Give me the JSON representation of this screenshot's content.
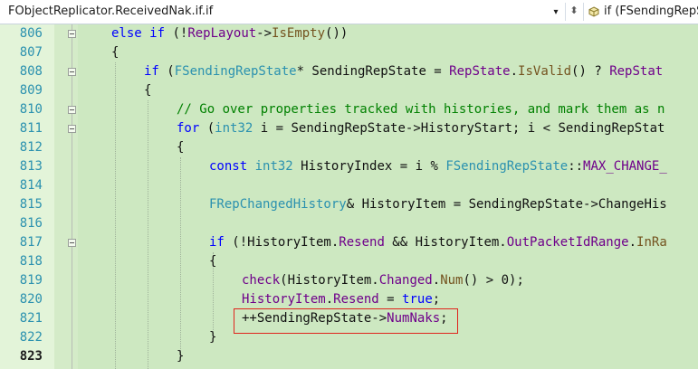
{
  "navbar": {
    "scope_label": "FObjectReplicator.ReceivedNak.if.if",
    "scope_dropdown_glyph": "▾",
    "split_glyph": "⬍",
    "member_label": "if (FSendingRepSt",
    "member_icon": "scope-cube-icon"
  },
  "editor": {
    "current_line": "823",
    "lines": [
      {
        "n": "806"
      },
      {
        "n": "807"
      },
      {
        "n": "808"
      },
      {
        "n": "809"
      },
      {
        "n": "810"
      },
      {
        "n": "811"
      },
      {
        "n": "812"
      },
      {
        "n": "813"
      },
      {
        "n": "814"
      },
      {
        "n": "815"
      },
      {
        "n": "816"
      },
      {
        "n": "817"
      },
      {
        "n": "818"
      },
      {
        "n": "819"
      },
      {
        "n": "820"
      },
      {
        "n": "821"
      },
      {
        "n": "822"
      },
      {
        "n": "823"
      }
    ],
    "code": {
      "l806": {
        "a": "else",
        "b": " ",
        "c": "if",
        "d": " (!",
        "e": "RepLayout",
        "f": "->",
        "g": "IsEmpty",
        "h": "())"
      },
      "l807": {
        "a": "{"
      },
      "l808": {
        "a": "if",
        "b": " (",
        "c": "FSendingRepState",
        "d": "* SendingRepState = ",
        "e": "RepState",
        "f": ".",
        "g": "IsValid",
        "h": "() ? ",
        "i": "RepStat"
      },
      "l809": {
        "a": "{"
      },
      "l810": {
        "a": "// Go over properties tracked with histories, and mark them as n"
      },
      "l811": {
        "a": "for",
        "b": " (",
        "c": "int32",
        "d": " i = SendingRepState->HistoryStart; i < SendingRepStat"
      },
      "l812": {
        "a": "{"
      },
      "l813": {
        "a": "const",
        "b": " ",
        "c": "int32",
        "d": " HistoryIndex = i % ",
        "e": "FSendingRepState",
        "f": "::",
        "g": "MAX_CHANGE_"
      },
      "l815": {
        "a": "FRepChangedHistory",
        "b": "& HistoryItem = SendingRepState->ChangeHis"
      },
      "l817": {
        "a": "if",
        "b": " (!HistoryItem.",
        "c": "Resend",
        "d": " && HistoryItem.",
        "e": "OutPacketIdRange",
        "f": ".",
        "g": "InRa"
      },
      "l818": {
        "a": "{"
      },
      "l819": {
        "a": "check",
        "b": "(HistoryItem.",
        "c": "Changed",
        "d": ".",
        "e": "Num",
        "f": "() > 0);"
      },
      "l820": {
        "a": "HistoryItem",
        "b": ".",
        "c": "Resend",
        "d": " = ",
        "e": "true",
        "f": ";"
      },
      "l821": {
        "a": "++SendingRepState->",
        "b": "NumNaks",
        "c": ";"
      },
      "l822": {
        "a": "}"
      },
      "l823": {
        "a": "}"
      }
    }
  },
  "colors": {
    "keyword": "#0000ff",
    "type": "#2b91af",
    "function": "#74531f",
    "comment": "#008000",
    "macro": "#6f008a",
    "line_number": "#2b91af",
    "editor_background": "#cde8c1",
    "highlight_box": "#e0241c"
  }
}
